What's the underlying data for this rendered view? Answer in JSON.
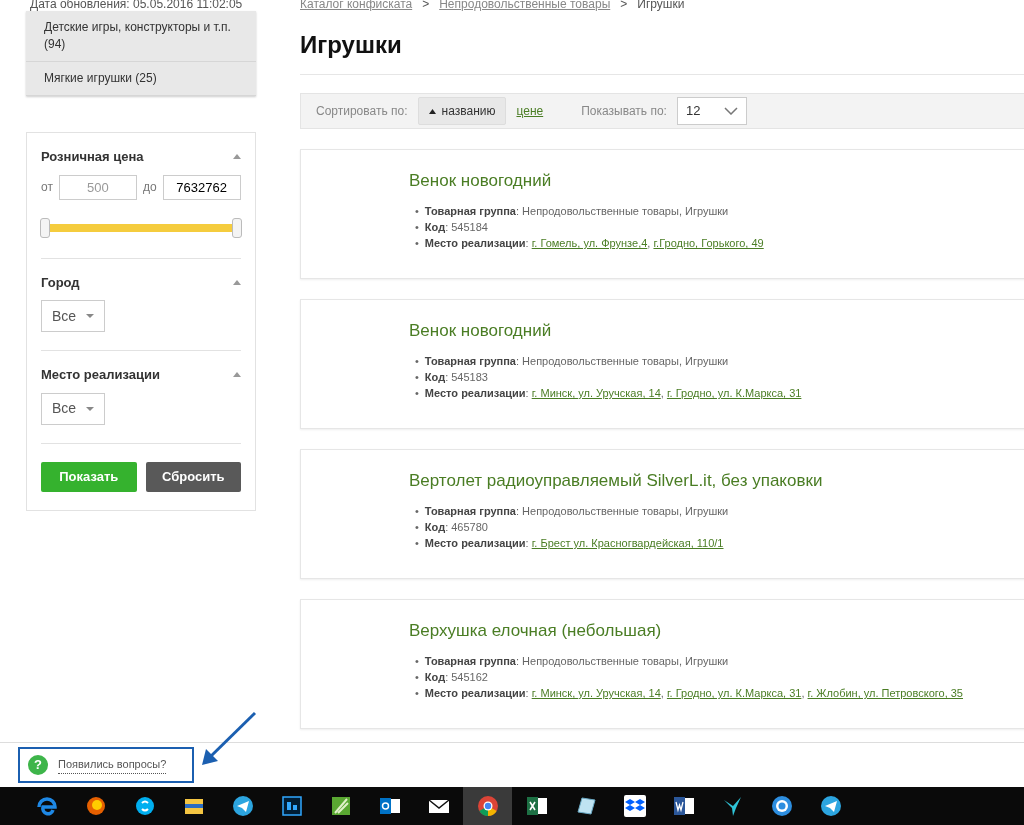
{
  "update_date": "Дата обновления: 05.05.2016 11:02:05",
  "categories": [
    {
      "label": "Детские игры, конструкторы и т.п. (94)"
    },
    {
      "label": "Мягкие игрушки (25)"
    }
  ],
  "filters": [
    {
      "kind": "range",
      "title": "Розничная цена",
      "expanded": true,
      "from_label": "от",
      "from_placeholder": "500",
      "to_label": "до",
      "to_value": "7632762",
      "level": 1
    },
    {
      "kind": "select",
      "title": "Город",
      "expanded": true,
      "value": "Все"
    },
    {
      "kind": "select",
      "title": "Место реализации",
      "expanded": true,
      "value": "Все"
    }
  ],
  "filter_buttons": [
    {
      "label": "Показать",
      "kind": "primary"
    },
    {
      "label": "Сбросить",
      "kind": "secondary"
    }
  ],
  "breadcrumbs": [
    {
      "label": "Каталог конфиската",
      "link": true
    },
    {
      "label": "Непродовольственные товары",
      "link": true
    },
    {
      "label": "Игрушки",
      "link": false
    }
  ],
  "breadcrumb_separator": ">",
  "bullet": "•",
  "page_title": "Игрушки",
  "sort": {
    "label": "Сортировать по:",
    "options": [
      {
        "label": "названию",
        "selected": true
      },
      {
        "label": "цене",
        "selected": false
      }
    ],
    "per_page_label": "Показывать по:",
    "per_page": "12"
  },
  "products": [
    {
      "title": "Венок новогодний",
      "lines": [
        "**Товарная группа**: Непродовольственные товары, Игрушки",
        "**Код**: 545184"
      ],
      "location": [
        {
          "text": "**Место реализации**: "
        },
        {
          "link": "г. Гомель, ул. Фрунзе,4"
        },
        {
          "text": ", "
        },
        {
          "link": "г.Гродно, Горького, 49"
        }
      ]
    },
    {
      "title": "Венок новогодний",
      "lines": [
        "**Товарная группа**: Непродовольственные товары, Игрушки",
        "**Код**: 545183"
      ],
      "location": [
        {
          "text": "**Место реализации**: "
        },
        {
          "link": "г. Минск, ул. Уручская, 14"
        },
        {
          "text": ", "
        },
        {
          "link": "г. Гродно, ул. К.Маркса, 31"
        }
      ]
    },
    {
      "title": "Вертолет радиоуправляемый SilverL.it, без упаковки",
      "lines": [
        "**Товарная группа**: Непродовольственные товары, Игрушки",
        "**Код**: 465780"
      ],
      "location": [
        {
          "text": "**Место реализации**: "
        },
        {
          "link": "г. Брест ул. Красногвардейская, 110/1"
        }
      ]
    },
    {
      "title": "Верхушка елочная (небольшая)",
      "lines": [
        "**Товарная группа**: Непродовольственные товары, Игрушки",
        "**Код**: 545162"
      ],
      "location": [
        {
          "text": "**Место реализации**: "
        },
        {
          "link": "г. Минск, ул. Уручская, 14"
        },
        {
          "text": ", "
        },
        {
          "link": "г. Гродно, ул. К.Маркса, 31"
        },
        {
          "text": ", "
        },
        {
          "link": "г. Жлобин, ул. Петровского, 35"
        }
      ]
    }
  ],
  "help": {
    "icon_glyph": "?",
    "label": "Появились вопросы?",
    "highlighted": true
  },
  "taskbar": [
    {
      "kind": "edge",
      "selected": false
    },
    {
      "kind": "firefox",
      "selected": false
    },
    {
      "kind": "skype",
      "selected": false
    },
    {
      "kind": "folder",
      "selected": false
    },
    {
      "kind": "telegram",
      "selected": false
    },
    {
      "kind": "photoshop",
      "selected": false
    },
    {
      "kind": "leaf",
      "selected": false
    },
    {
      "kind": "outlook",
      "selected": false
    },
    {
      "kind": "mail",
      "selected": false
    },
    {
      "kind": "chrome",
      "selected": true
    },
    {
      "kind": "excel",
      "selected": false
    },
    {
      "kind": "notes",
      "selected": false
    },
    {
      "kind": "dropbox",
      "selected": false
    },
    {
      "kind": "word",
      "selected": false
    },
    {
      "kind": "bird",
      "selected": false
    },
    {
      "kind": "bcircle",
      "selected": false
    },
    {
      "kind": "telegram",
      "selected": false
    }
  ]
}
